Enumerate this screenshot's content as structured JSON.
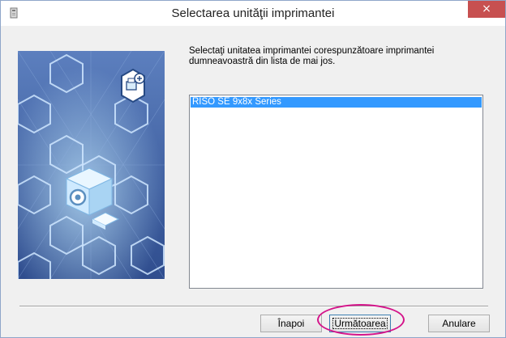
{
  "window": {
    "title": "Selectarea unităţii imprimantei",
    "close_label": "×"
  },
  "icons": {
    "app": "installer-icon",
    "close": "close-icon",
    "badge": "add-printer-icon",
    "cube": "printer-cube-icon"
  },
  "colors": {
    "accent": "#3399ff",
    "close": "#c75050",
    "highlight": "#d4148a",
    "art_background": "#3f61a6"
  },
  "instructions": {
    "line1": "Selectaţi unitatea imprimantei corespunzătoare imprimantei",
    "line2": "dumneavoastră din lista de mai jos."
  },
  "printer_list": {
    "items": [
      {
        "label": "RISO SE 9x8x Series",
        "selected": true
      }
    ]
  },
  "buttons": {
    "back": "Înapoi",
    "next": "Următoarea",
    "cancel": "Anulare"
  }
}
